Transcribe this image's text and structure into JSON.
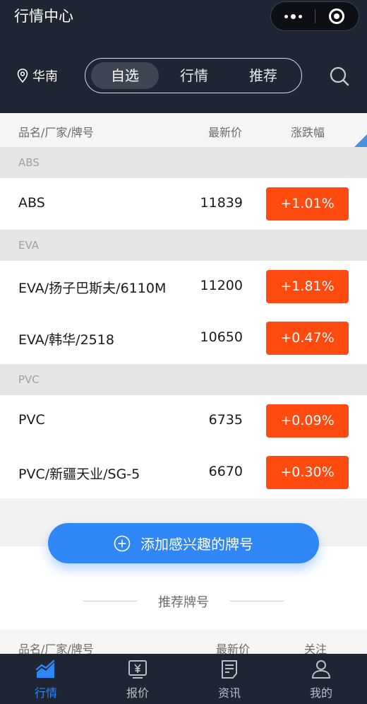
{
  "header": {
    "title": "行情中心",
    "region": "华南",
    "tabs": [
      "自选",
      "行情",
      "推荐"
    ]
  },
  "table": {
    "col_name": "品名/厂家/牌号",
    "col_price": "最新价",
    "col_change": "涨跌幅"
  },
  "groups": [
    {
      "label": "ABS",
      "rows": [
        {
          "name": "ABS",
          "price": "11839",
          "change": "+1.01%"
        }
      ]
    },
    {
      "label": "EVA",
      "rows": [
        {
          "name": "EVA/扬子巴斯夫/6110M",
          "price": "11200",
          "change": "+1.81%"
        },
        {
          "name": "EVA/韩华/2518",
          "price": "10650",
          "change": "+0.47%"
        }
      ]
    },
    {
      "label": "PVC",
      "rows": [
        {
          "name": "PVC",
          "price": "6735",
          "change": "+0.09%"
        },
        {
          "name": "PVC/新疆天业/SG-5",
          "price": "6670",
          "change": "+0.30%"
        }
      ]
    }
  ],
  "add_button": "添加感兴趣的牌号",
  "recommend": {
    "title": "推荐牌号",
    "col_name": "品名/厂家/牌号",
    "col_price": "最新价",
    "col_follow": "关注"
  },
  "tabbar": {
    "items": [
      {
        "label": "行情",
        "icon": "chart-icon"
      },
      {
        "label": "报价",
        "icon": "yen-icon"
      },
      {
        "label": "资讯",
        "icon": "news-icon"
      },
      {
        "label": "我的",
        "icon": "user-icon"
      }
    ]
  },
  "colors": {
    "header_bg": "#1e2633",
    "accent": "#2f86f6",
    "up": "#ff4a10"
  }
}
